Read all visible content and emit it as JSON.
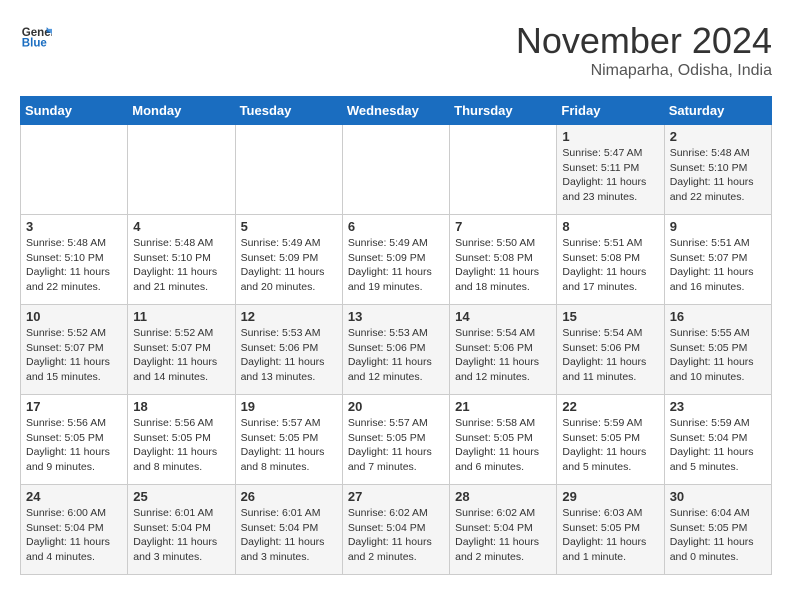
{
  "header": {
    "logo_line1": "General",
    "logo_line2": "Blue",
    "month": "November 2024",
    "location": "Nimaparha, Odisha, India"
  },
  "weekdays": [
    "Sunday",
    "Monday",
    "Tuesday",
    "Wednesday",
    "Thursday",
    "Friday",
    "Saturday"
  ],
  "weeks": [
    [
      {
        "day": "",
        "text": ""
      },
      {
        "day": "",
        "text": ""
      },
      {
        "day": "",
        "text": ""
      },
      {
        "day": "",
        "text": ""
      },
      {
        "day": "",
        "text": ""
      },
      {
        "day": "1",
        "text": "Sunrise: 5:47 AM\nSunset: 5:11 PM\nDaylight: 11 hours and 23 minutes."
      },
      {
        "day": "2",
        "text": "Sunrise: 5:48 AM\nSunset: 5:10 PM\nDaylight: 11 hours and 22 minutes."
      }
    ],
    [
      {
        "day": "3",
        "text": "Sunrise: 5:48 AM\nSunset: 5:10 PM\nDaylight: 11 hours and 22 minutes."
      },
      {
        "day": "4",
        "text": "Sunrise: 5:48 AM\nSunset: 5:10 PM\nDaylight: 11 hours and 21 minutes."
      },
      {
        "day": "5",
        "text": "Sunrise: 5:49 AM\nSunset: 5:09 PM\nDaylight: 11 hours and 20 minutes."
      },
      {
        "day": "6",
        "text": "Sunrise: 5:49 AM\nSunset: 5:09 PM\nDaylight: 11 hours and 19 minutes."
      },
      {
        "day": "7",
        "text": "Sunrise: 5:50 AM\nSunset: 5:08 PM\nDaylight: 11 hours and 18 minutes."
      },
      {
        "day": "8",
        "text": "Sunrise: 5:51 AM\nSunset: 5:08 PM\nDaylight: 11 hours and 17 minutes."
      },
      {
        "day": "9",
        "text": "Sunrise: 5:51 AM\nSunset: 5:07 PM\nDaylight: 11 hours and 16 minutes."
      }
    ],
    [
      {
        "day": "10",
        "text": "Sunrise: 5:52 AM\nSunset: 5:07 PM\nDaylight: 11 hours and 15 minutes."
      },
      {
        "day": "11",
        "text": "Sunrise: 5:52 AM\nSunset: 5:07 PM\nDaylight: 11 hours and 14 minutes."
      },
      {
        "day": "12",
        "text": "Sunrise: 5:53 AM\nSunset: 5:06 PM\nDaylight: 11 hours and 13 minutes."
      },
      {
        "day": "13",
        "text": "Sunrise: 5:53 AM\nSunset: 5:06 PM\nDaylight: 11 hours and 12 minutes."
      },
      {
        "day": "14",
        "text": "Sunrise: 5:54 AM\nSunset: 5:06 PM\nDaylight: 11 hours and 12 minutes."
      },
      {
        "day": "15",
        "text": "Sunrise: 5:54 AM\nSunset: 5:06 PM\nDaylight: 11 hours and 11 minutes."
      },
      {
        "day": "16",
        "text": "Sunrise: 5:55 AM\nSunset: 5:05 PM\nDaylight: 11 hours and 10 minutes."
      }
    ],
    [
      {
        "day": "17",
        "text": "Sunrise: 5:56 AM\nSunset: 5:05 PM\nDaylight: 11 hours and 9 minutes."
      },
      {
        "day": "18",
        "text": "Sunrise: 5:56 AM\nSunset: 5:05 PM\nDaylight: 11 hours and 8 minutes."
      },
      {
        "day": "19",
        "text": "Sunrise: 5:57 AM\nSunset: 5:05 PM\nDaylight: 11 hours and 8 minutes."
      },
      {
        "day": "20",
        "text": "Sunrise: 5:57 AM\nSunset: 5:05 PM\nDaylight: 11 hours and 7 minutes."
      },
      {
        "day": "21",
        "text": "Sunrise: 5:58 AM\nSunset: 5:05 PM\nDaylight: 11 hours and 6 minutes."
      },
      {
        "day": "22",
        "text": "Sunrise: 5:59 AM\nSunset: 5:05 PM\nDaylight: 11 hours and 5 minutes."
      },
      {
        "day": "23",
        "text": "Sunrise: 5:59 AM\nSunset: 5:04 PM\nDaylight: 11 hours and 5 minutes."
      }
    ],
    [
      {
        "day": "24",
        "text": "Sunrise: 6:00 AM\nSunset: 5:04 PM\nDaylight: 11 hours and 4 minutes."
      },
      {
        "day": "25",
        "text": "Sunrise: 6:01 AM\nSunset: 5:04 PM\nDaylight: 11 hours and 3 minutes."
      },
      {
        "day": "26",
        "text": "Sunrise: 6:01 AM\nSunset: 5:04 PM\nDaylight: 11 hours and 3 minutes."
      },
      {
        "day": "27",
        "text": "Sunrise: 6:02 AM\nSunset: 5:04 PM\nDaylight: 11 hours and 2 minutes."
      },
      {
        "day": "28",
        "text": "Sunrise: 6:02 AM\nSunset: 5:04 PM\nDaylight: 11 hours and 2 minutes."
      },
      {
        "day": "29",
        "text": "Sunrise: 6:03 AM\nSunset: 5:05 PM\nDaylight: 11 hours and 1 minute."
      },
      {
        "day": "30",
        "text": "Sunrise: 6:04 AM\nSunset: 5:05 PM\nDaylight: 11 hours and 0 minutes."
      }
    ]
  ]
}
